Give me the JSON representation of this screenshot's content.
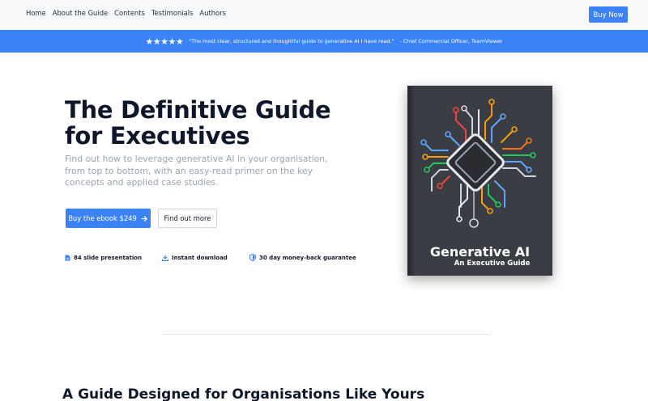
{
  "nav": {
    "links": [
      "Home",
      "About the Guide",
      "Contents",
      "Testimonials",
      "Authors"
    ],
    "buy_now": "Buy Now"
  },
  "banner": {
    "stars": "★★★★★",
    "quote": "\"The most clear, structured and thoughtful guide to generative AI I have read.\"",
    "attribution": "- Chief Commercial Officer, TeamViewer"
  },
  "hero": {
    "title": "The Definitive Guide for Executives",
    "subtitle": "Find out how to leverage generative AI in your organisation, from top to bottom, with an easy-read primer on the key concepts and applied case studies.",
    "primary_button": "Buy the ebook $249",
    "secondary_button": "Find out more",
    "features": [
      {
        "icon": "document-icon",
        "label": "84 slide presentation"
      },
      {
        "icon": "download-icon",
        "label": "Instant download"
      },
      {
        "icon": "shield-icon",
        "label": "30 day money-back guarantee"
      }
    ]
  },
  "book": {
    "title": "Generative AI",
    "subtitle": "An Executive Guide"
  },
  "section": {
    "title": "A Guide Designed for Organisations Like Yours"
  },
  "colors": {
    "accent": "#3b82f6",
    "book_cover": "#3a3d44"
  }
}
